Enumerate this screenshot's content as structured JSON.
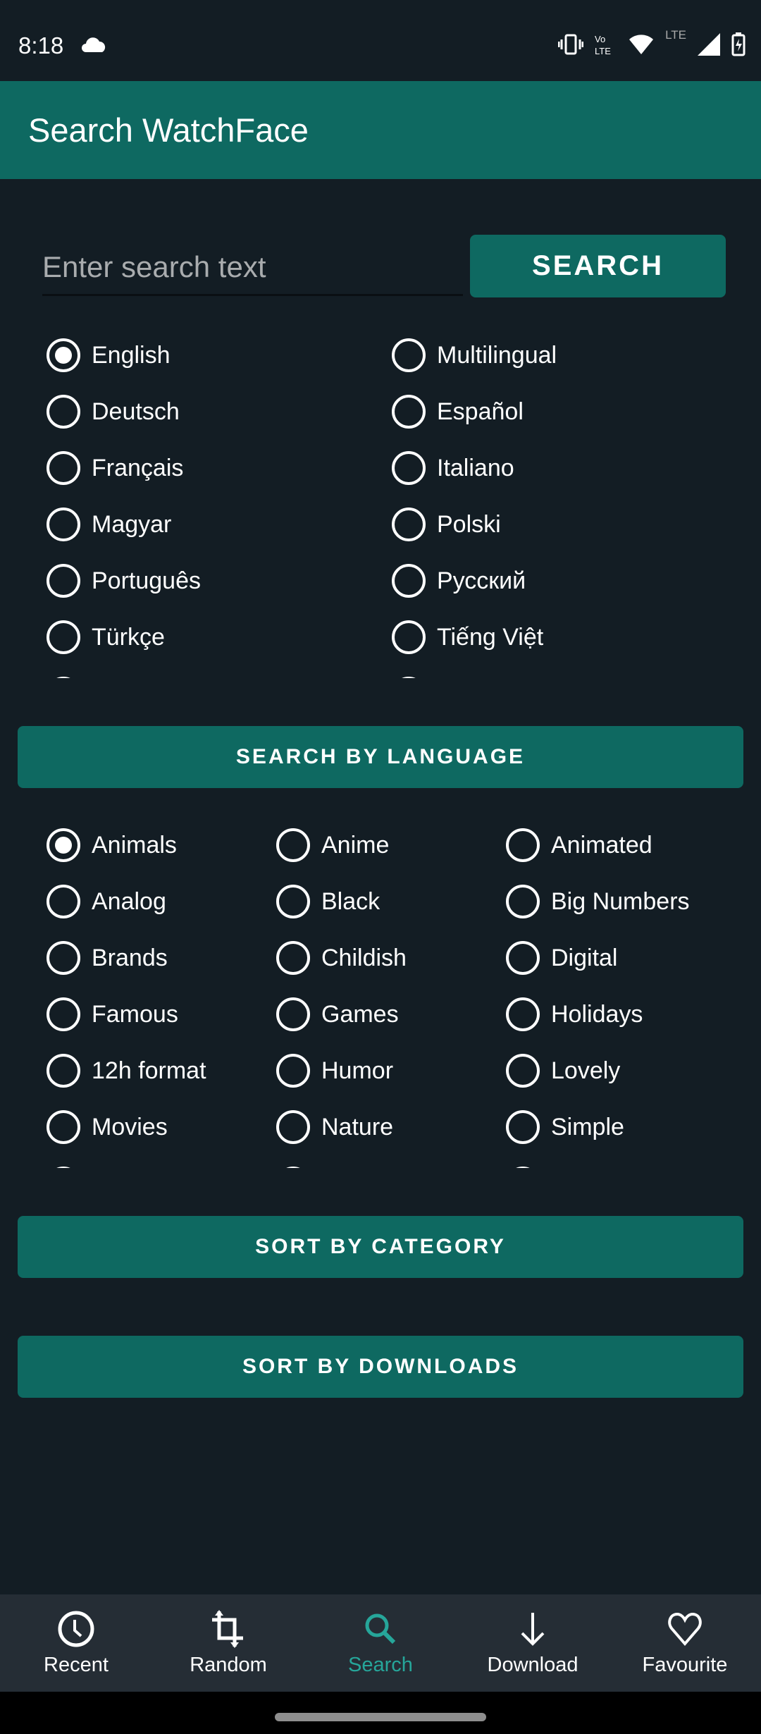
{
  "status_bar": {
    "time": "8:18",
    "icons": [
      "cloud-icon",
      "vibrate-icon",
      "volte-icon",
      "wifi-icon",
      "lte-icon",
      "signal-icon",
      "battery-charging-icon"
    ],
    "lte": "LTE"
  },
  "app_bar": {
    "title": "Search WatchFace"
  },
  "search": {
    "placeholder": "Enter search text",
    "value": "",
    "button": "SEARCH"
  },
  "languages": {
    "selected": "English",
    "options": [
      "English",
      "Multilingual",
      "Deutsch",
      "Español",
      "Français",
      "Italiano",
      "Magyar",
      "Polski",
      "Português",
      "Русский",
      "Türkçe",
      "Tiếng Việt"
    ],
    "button": "SEARCH BY LANGUAGE"
  },
  "categories": {
    "selected": "Animals",
    "options": [
      "Animals",
      "Anime",
      "Animated",
      "Analog",
      "Black",
      "Big Numbers",
      "Brands",
      "Childish",
      "Digital",
      "Famous",
      "Games",
      "Holidays",
      "12h format",
      "Humor",
      "Lovely",
      "Movies",
      "Nature",
      "Simple"
    ],
    "button": "SORT BY CATEGORY"
  },
  "sort_downloads": {
    "button": "SORT BY DOWNLOADS"
  },
  "bottom_nav": {
    "active": "Search",
    "accent": "#26a69a",
    "items": [
      {
        "label": "Recent",
        "icon": "clock-icon"
      },
      {
        "label": "Random",
        "icon": "crop-icon"
      },
      {
        "label": "Search",
        "icon": "search-icon"
      },
      {
        "label": "Download",
        "icon": "download-icon"
      },
      {
        "label": "Favourite",
        "icon": "heart-icon"
      }
    ]
  }
}
